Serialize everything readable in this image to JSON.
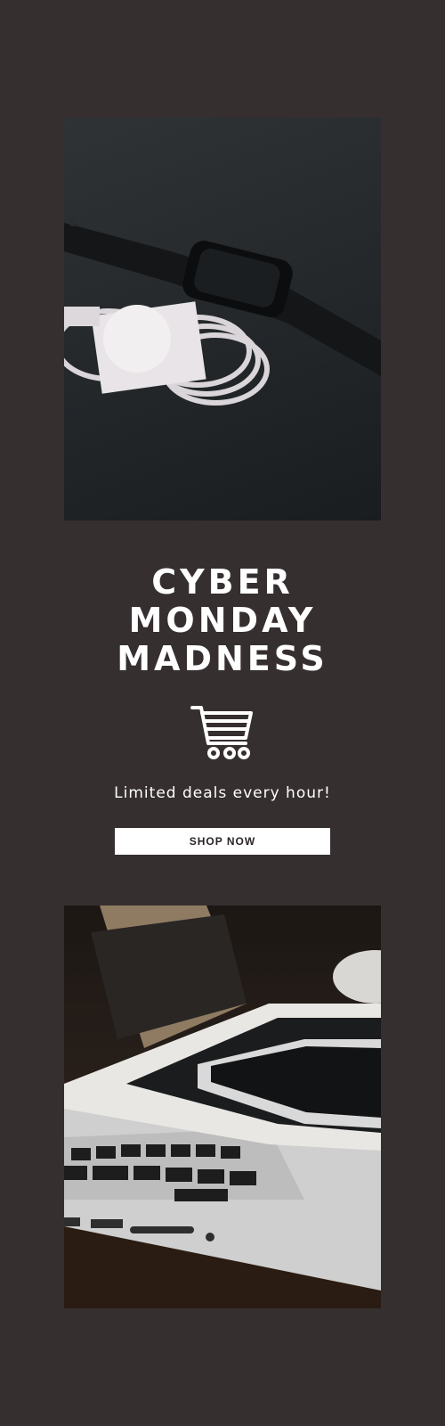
{
  "headline": {
    "line1": "CYBER",
    "line2": "MONDAY",
    "line3": "MADNESS"
  },
  "tagline": "Limited deals every hour!",
  "cta": {
    "label": "SHOP NOW"
  },
  "icons": {
    "cart": "shopping-cart-icon"
  },
  "colors": {
    "background": "#362f2f",
    "text": "#ffffff",
    "button_bg": "#ffffff",
    "button_text": "#2a2424"
  }
}
